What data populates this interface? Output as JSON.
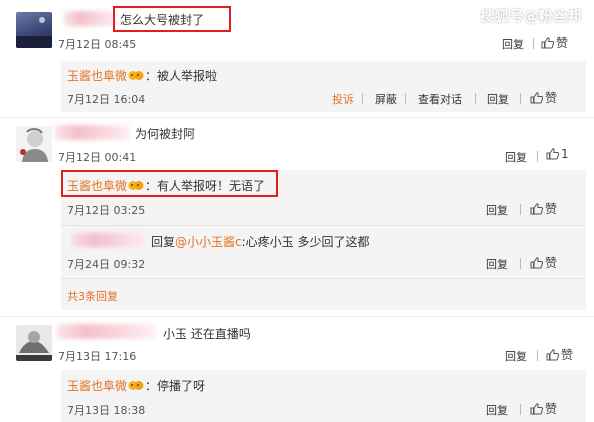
{
  "watermark": "搜狐号@粉丝邦",
  "actions": {
    "reply": "回复",
    "like": "赞",
    "report": "投诉",
    "block": "屏蔽",
    "view_conversation": "查看对话"
  },
  "comments": [
    {
      "text": "怎么大号被封了",
      "time": "7月12日 08:45",
      "replies": [
        {
          "user": "玉酱也阜微",
          "text": "：被人举报啦",
          "time": "7月12日 16:04"
        }
      ]
    },
    {
      "text": "为何被封阿",
      "time": "7月12日 00:41",
      "likes": "1",
      "replies": [
        {
          "user": "玉酱也阜微",
          "text": "：有人举报呀！无语了",
          "time": "7月12日 03:25"
        },
        {
          "prefix": "回复",
          "mention": "@小小玉酱c",
          "text": ":心疼小玉  多少回了这都",
          "time": "7月24日 09:32"
        }
      ],
      "more": "共3条回复"
    },
    {
      "text": "小玉  还在直播吗",
      "time": "7月13日 17:16",
      "replies": [
        {
          "user": "玉酱也阜微",
          "text": "：停播了呀",
          "time": "7月13日 18:38"
        }
      ]
    }
  ]
}
